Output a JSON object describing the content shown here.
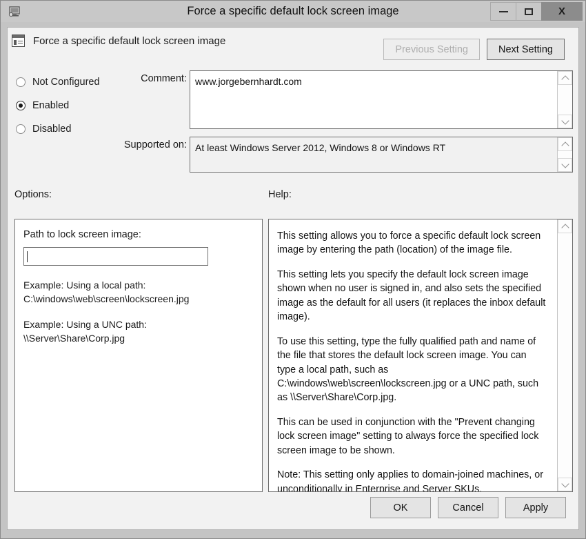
{
  "window": {
    "title": "Force a specific default lock screen image",
    "icon": "computer-monitor-icon",
    "controls": {
      "minimize": "minimize-icon",
      "maximize": "maximize-icon",
      "close": "X"
    }
  },
  "header": {
    "icon": "policy-setting-icon",
    "title": "Force a specific default lock screen image",
    "previous_button": "Previous Setting",
    "next_button": "Next Setting"
  },
  "state": {
    "options": [
      {
        "label": "Not Configured",
        "selected": false
      },
      {
        "label": "Enabled",
        "selected": true
      },
      {
        "label": "Disabled",
        "selected": false
      }
    ]
  },
  "comment": {
    "label": "Comment:",
    "value": "www.jorgebernhardt.com"
  },
  "supported_on": {
    "label": "Supported on:",
    "value": "At least Windows Server 2012, Windows 8 or Windows RT"
  },
  "sections": {
    "options_label": "Options:",
    "help_label": "Help:"
  },
  "options_panel": {
    "path_label": "Path to lock screen image:",
    "path_value": "",
    "path_placeholder": "",
    "examples": [
      "Example: Using a local path:\nC:\\windows\\web\\screen\\lockscreen.jpg",
      "Example: Using a UNC path:\n\\\\Server\\Share\\Corp.jpg"
    ]
  },
  "help_panel": {
    "paragraphs": [
      "This setting allows you to force a specific default lock screen image by entering the path (location) of the image file.",
      "This setting lets you specify the default lock screen image shown when no user is signed in, and also sets the specified image as the default for all users (it replaces the inbox default image).",
      "To use this setting, type the fully qualified path and name of the file that stores the default lock screen image. You can type a local path, such as C:\\windows\\web\\screen\\lockscreen.jpg or a UNC path, such as \\\\Server\\Share\\Corp.jpg.",
      "This can be used in conjunction with the \"Prevent changing lock screen image\" setting to always force the specified lock screen image to be shown.",
      "Note: This setting only applies to domain-joined machines, or unconditionally in Enterprise and Server SKUs."
    ]
  },
  "footer": {
    "ok": "OK",
    "cancel": "Cancel",
    "apply": "Apply"
  },
  "colors": {
    "titlebar": "#c8c8c8",
    "dialog_bg": "#f2f2f2",
    "close_btn": "#8c8c8c",
    "border": "#6e6e6e"
  }
}
